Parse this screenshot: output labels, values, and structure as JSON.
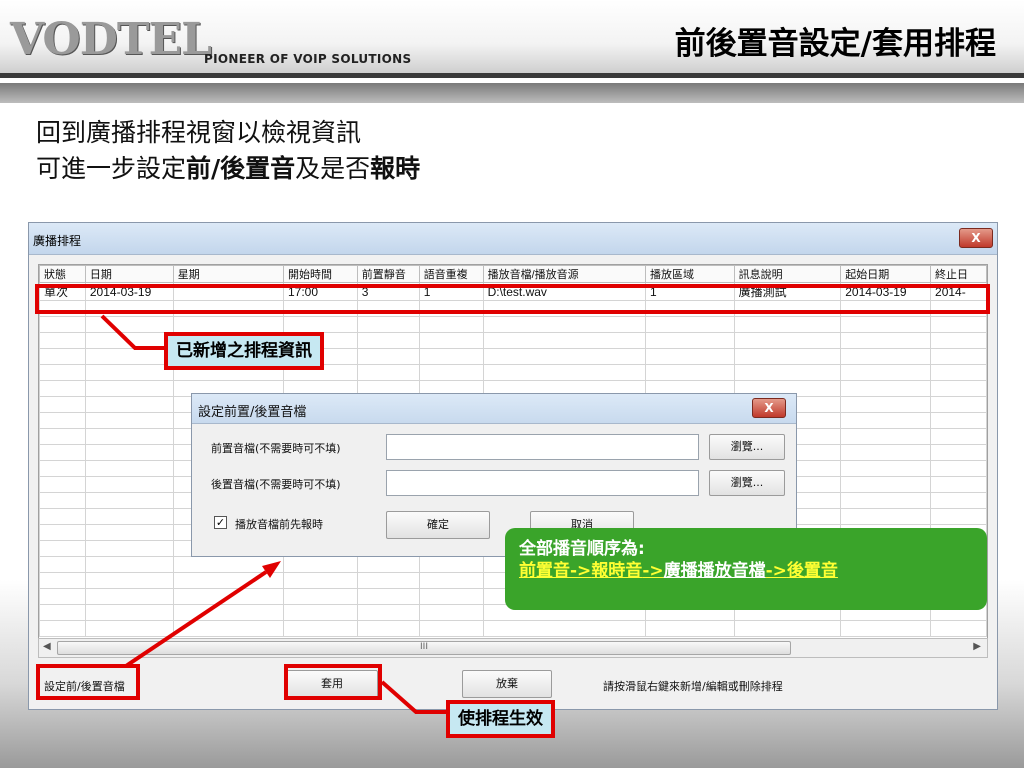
{
  "header": {
    "logo": "VODTEL",
    "tagline": "PIONEER OF VOIP SOLUTIONS",
    "title": "前後置音設定/套用排程"
  },
  "intro": {
    "line1": "回到廣播排程視窗以檢視資訊",
    "line2_part1": "可進一步設定",
    "line2_bold1": "前/後置音",
    "line2_part2": "及是否",
    "line2_bold2": "報時"
  },
  "window": {
    "title": "廣播排程",
    "close_label": "X",
    "columns": [
      "狀態",
      "日期",
      "星期",
      "開始時間",
      "前置靜音",
      "語音重複",
      "播放音檔/播放音源",
      "播放區域",
      "訊息說明",
      "起始日期",
      "終止日"
    ],
    "rows": [
      [
        "單次",
        "2014-03-19",
        "",
        "17:00",
        "3",
        "1",
        "D:\\test.wav",
        "1",
        "廣播測試",
        "2014-03-19",
        "2014-"
      ]
    ],
    "scroll_mark": "III",
    "buttons": {
      "set_pre_post": "設定前/後置音檔",
      "apply": "套用",
      "discard": "放棄"
    },
    "hint": "請按滑鼠右鍵來新增/編輯或刪除排程"
  },
  "dialog": {
    "title": "設定前置/後置音檔",
    "close_label": "X",
    "pre_label": "前置音檔(不需要時可不填)",
    "pre_value": "",
    "post_label": "後置音檔(不需要時可不填)",
    "post_value": "",
    "browse_label": "瀏覽...",
    "announce_checkbox_label": "播放音檔前先報時",
    "announce_checked": true,
    "confirm_label": "確定",
    "cancel_label": "取消"
  },
  "annotations": {
    "new_schedule": "已新增之排程資訊",
    "apply_effect": "使排程生效",
    "order_title": "全部播音順序為:",
    "order_steps": [
      "前置音",
      "報時音",
      "廣播播放音檔",
      "後置音"
    ],
    "order_arrow": "->"
  },
  "colors": {
    "annotation_red": "#e00000",
    "note_green": "#3aa42a",
    "callout_bg": "#c6e8f2",
    "arrow_yellow": "#ffff33"
  }
}
